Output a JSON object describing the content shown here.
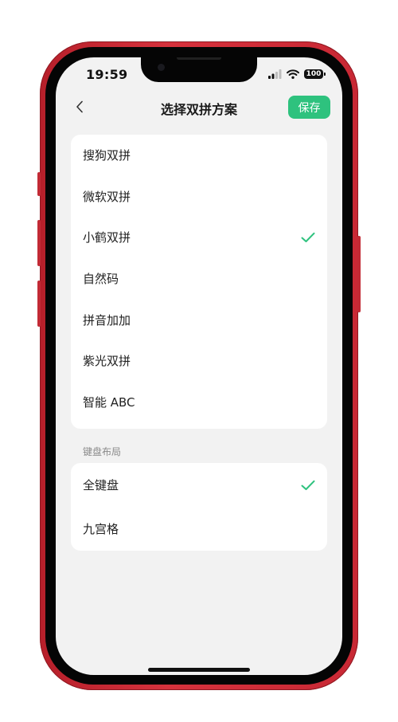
{
  "status_bar": {
    "time": "19:59",
    "battery": "100"
  },
  "nav": {
    "title": "选择双拼方案",
    "save_label": "保存"
  },
  "schemes": [
    {
      "label": "搜狗双拼",
      "selected": false
    },
    {
      "label": "微软双拼",
      "selected": false
    },
    {
      "label": "小鹤双拼",
      "selected": true
    },
    {
      "label": "自然码",
      "selected": false
    },
    {
      "label": "拼音加加",
      "selected": false
    },
    {
      "label": "紫光双拼",
      "selected": false
    },
    {
      "label": "智能 ABC",
      "selected": false
    }
  ],
  "keyboard_section": {
    "label": "键盘布局",
    "items": [
      {
        "label": "全键盘",
        "selected": true
      },
      {
        "label": "九宫格",
        "selected": false
      }
    ]
  },
  "colors": {
    "accent": "#2ec27e",
    "phone_frame": "#c82834",
    "screen_bg": "#f2f2f2"
  }
}
